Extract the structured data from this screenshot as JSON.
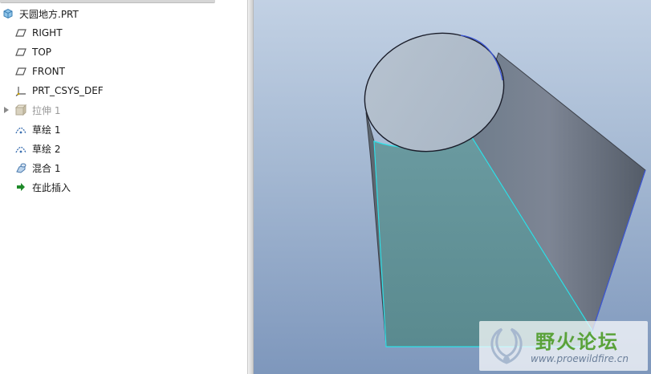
{
  "model_tree": {
    "root": {
      "label": "天圆地方.PRT",
      "icon": "part-icon"
    },
    "items": [
      {
        "label": "RIGHT",
        "icon": "datum-plane-icon"
      },
      {
        "label": "TOP",
        "icon": "datum-plane-icon"
      },
      {
        "label": "FRONT",
        "icon": "datum-plane-icon"
      },
      {
        "label": "PRT_CSYS_DEF",
        "icon": "coordinate-system-icon"
      },
      {
        "label": "拉伸 1",
        "icon": "extrude-icon",
        "suppressed": true,
        "expandable": true
      },
      {
        "label": "草绘 1",
        "icon": "sketch-icon"
      },
      {
        "label": "草绘 2",
        "icon": "sketch-icon"
      },
      {
        "label": "混合 1",
        "icon": "blend-icon"
      },
      {
        "label": "在此插入",
        "icon": "insert-here-arrow-icon"
      }
    ]
  },
  "viewport": {
    "background_top": "#c2d1e4",
    "background_bottom": "#7e97bc",
    "highlight_edge_color": "#2fe0e8",
    "selected_face_color": "#5c8f92"
  },
  "watermark": {
    "title": "野火论坛",
    "url": "www.proewildfire.cn"
  }
}
